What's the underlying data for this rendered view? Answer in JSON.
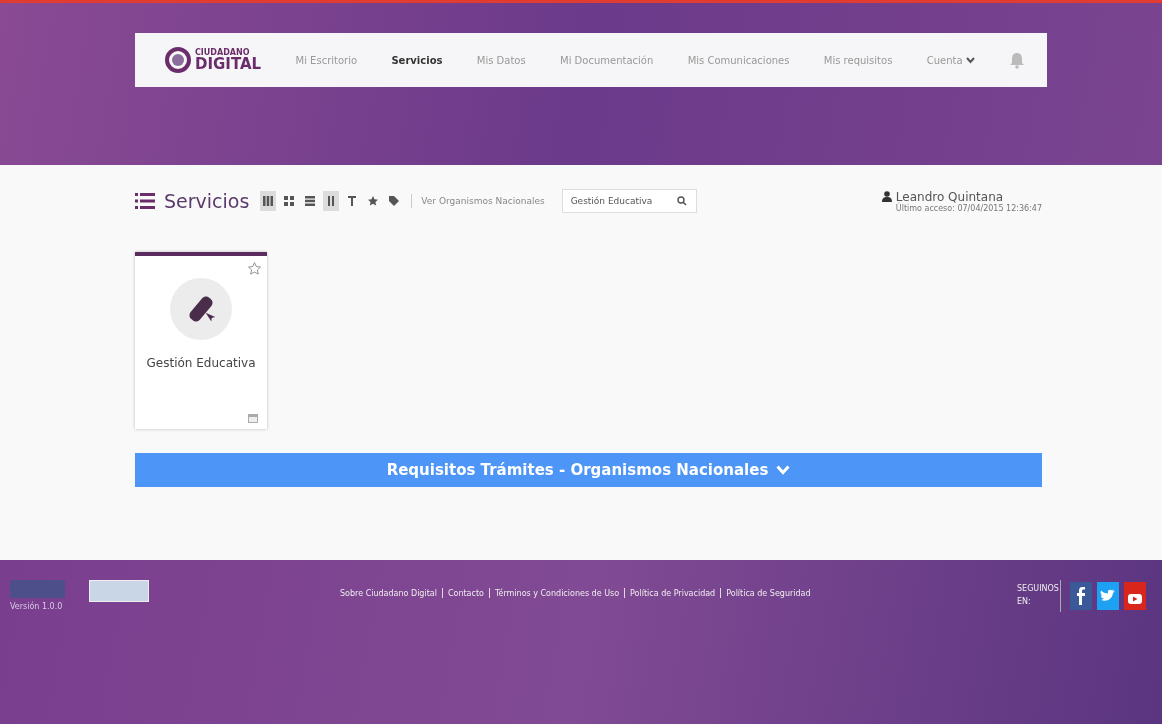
{
  "logo": {
    "top": "CIUDADANO",
    "bottom": "DIGITAL"
  },
  "nav": [
    {
      "label": "Mi Escritorio",
      "selected": false
    },
    {
      "label": "Servicios",
      "selected": true
    },
    {
      "label": "Mis Datos",
      "selected": false
    },
    {
      "label": "Mi Documentación",
      "selected": false
    },
    {
      "label": "Mis Comunicaciones",
      "selected": false
    },
    {
      "label": "Mis requisitos",
      "selected": false
    },
    {
      "label": "Cuenta",
      "selected": false
    }
  ],
  "toolbar": {
    "title": "Servicios",
    "views": [
      {
        "kind": "grid",
        "selected": true
      },
      {
        "kind": "tiles",
        "selected": false
      },
      {
        "kind": "list",
        "selected": false
      },
      {
        "kind": "sort",
        "selected": true
      },
      {
        "kind": "text",
        "selected": false
      },
      {
        "kind": "star",
        "selected": false
      },
      {
        "kind": "tag",
        "selected": false
      }
    ],
    "link": "Ver Organismos Nacionales",
    "search": {
      "value": "Gestión Educativa"
    }
  },
  "user": {
    "name": "Leandro Quintana",
    "last_access": "Último acceso: 07/04/2015 12:36:47"
  },
  "services": [
    {
      "title": "Gestión Educativa",
      "favorite": false
    }
  ],
  "banner": "Requisitos Trámites - Organismos Nacionales",
  "footer": {
    "version": "Versión 1.0.0",
    "links": [
      "Sobre Ciudadano Digital",
      "Contacto",
      "Términos y Condiciones de Uso",
      "Política de Privacidad",
      "Política de Seguridad"
    ],
    "follow": "SEGUINOS EN:"
  }
}
